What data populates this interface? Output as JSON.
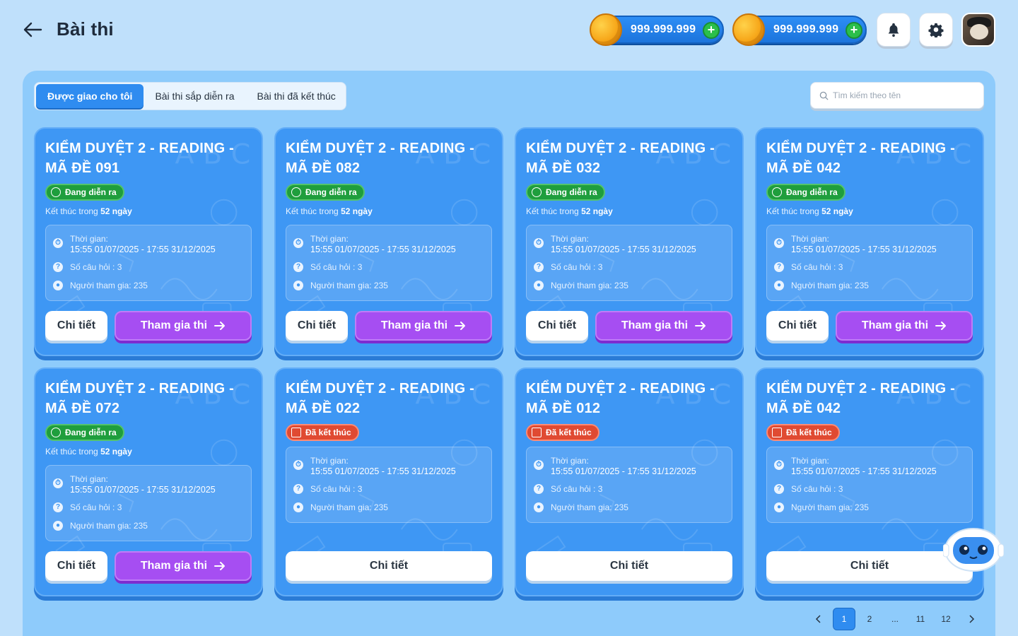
{
  "header": {
    "title": "Bài thi",
    "currency": [
      {
        "amount": "999.999.999",
        "icon": "gold-coin-icon"
      },
      {
        "amount": "999.999.999",
        "icon": "gold-coin-icon"
      }
    ],
    "plus_label": "+"
  },
  "tabs": [
    {
      "label": "Được giao cho tôi",
      "active": true
    },
    {
      "label": "Bài thi sắp diễn ra",
      "active": false
    },
    {
      "label": "Bài thi đã kết thúc",
      "active": false
    }
  ],
  "search": {
    "placeholder": "Tìm kiếm theo tên"
  },
  "labels": {
    "time": "Thời gian:",
    "questions": "Số câu hỏi : 3",
    "participants": "Người tham gia: 235",
    "ends_in_prefix": "Kết thúc trong",
    "ends_in_value": "52 ngày",
    "detail": "Chi tiết",
    "join": "Tham gia thi",
    "status_ongoing": "Đang diễn ra",
    "status_ended": "Đã kết thúc"
  },
  "cards": [
    {
      "title": "KIỂM DUYỆT 2 - READING - MÃ ĐỀ 091",
      "status": "ongoing",
      "time_range": "15:55 01/07/2025  - 17:55 31/12/2025"
    },
    {
      "title": "KIỂM DUYỆT 2 - READING - MÃ ĐỀ 082",
      "status": "ongoing",
      "time_range": "15:55 01/07/2025  - 17:55 31/12/2025"
    },
    {
      "title": "KIỂM DUYỆT 2 - READING - MÃ ĐỀ 032",
      "status": "ongoing",
      "time_range": "15:55 01/07/2025  - 17:55 31/12/2025"
    },
    {
      "title": "KIỂM DUYỆT 2 - READING - MÃ ĐỀ 042",
      "status": "ongoing",
      "time_range": "15:55 01/07/2025  - 17:55 31/12/2025"
    },
    {
      "title": "KIỂM DUYỆT 2 - READING - MÃ ĐỀ 072",
      "status": "ongoing",
      "time_range": "15:55 01/07/2025  - 17:55 31/12/2025"
    },
    {
      "title": "KIỂM DUYỆT 2 - READING - MÃ ĐỀ 022",
      "status": "ended",
      "time_range": "15:55 01/07/2025  - 17:55 31/12/2025"
    },
    {
      "title": "KIỂM DUYỆT 2 - READING - MÃ ĐỀ 012",
      "status": "ended",
      "time_range": "15:55 01/07/2025  - 17:55 31/12/2025"
    },
    {
      "title": "KIỂM DUYỆT 2 - READING - MÃ ĐỀ 042",
      "status": "ended",
      "time_range": "15:55 01/07/2025  - 17:55 31/12/2025"
    }
  ],
  "pagination": {
    "pages": [
      "1",
      "2",
      "...",
      "11",
      "12"
    ],
    "current": "1"
  },
  "colors": {
    "background": "#bfe0fb",
    "panel": "#8ecbfb",
    "card": "#3e97f4",
    "accent": "#2f8cf0",
    "join_button": "#a64ef2",
    "ongoing": "#1f9e3d",
    "ended": "#e04a32"
  }
}
